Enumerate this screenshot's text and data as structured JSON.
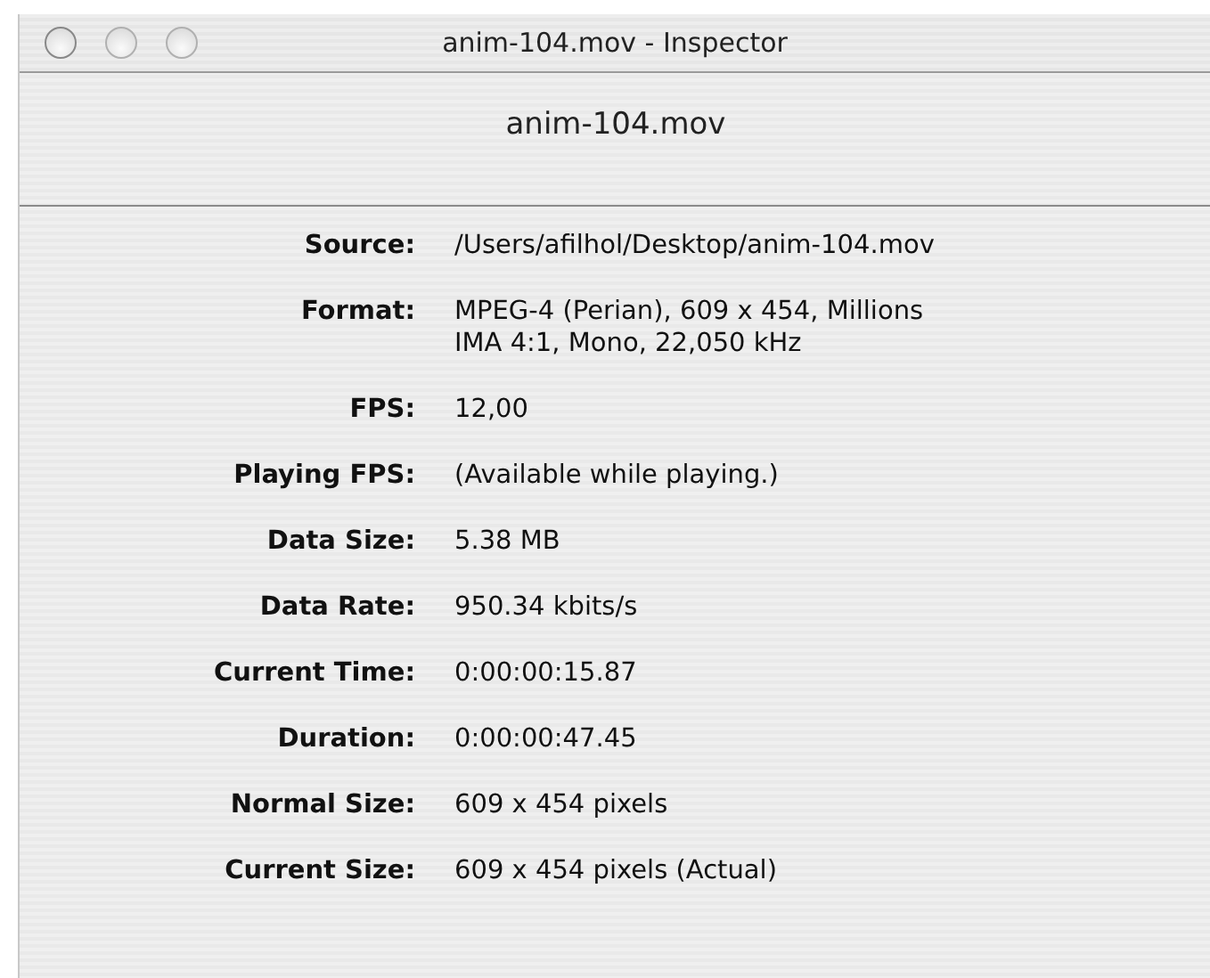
{
  "window": {
    "title": "anim-104.mov - Inspector"
  },
  "header": "anim-104.mov",
  "rows": [
    {
      "label": "Source:",
      "lines": [
        "/Users/afilhol/Desktop/anim-104.mov"
      ]
    },
    {
      "label": "Format:",
      "lines": [
        "MPEG-4 (Perian), 609 x 454, Millions",
        "IMA 4:1, Mono, 22,050 kHz"
      ]
    },
    {
      "label": "FPS:",
      "lines": [
        "12,00"
      ]
    },
    {
      "label": "Playing FPS:",
      "lines": [
        "(Available while playing.)"
      ]
    },
    {
      "label": "Data Size:",
      "lines": [
        "5.38 MB"
      ]
    },
    {
      "label": "Data Rate:",
      "lines": [
        "950.34 kbits/s"
      ]
    },
    {
      "label": "Current Time:",
      "lines": [
        "0:00:00:15.87"
      ]
    },
    {
      "label": "Duration:",
      "lines": [
        "0:00:00:47.45"
      ]
    },
    {
      "label": "Normal Size:",
      "lines": [
        "609 x 454 pixels"
      ]
    },
    {
      "label": "Current Size:",
      "lines": [
        "609 x 454 pixels (Actual)"
      ]
    }
  ]
}
